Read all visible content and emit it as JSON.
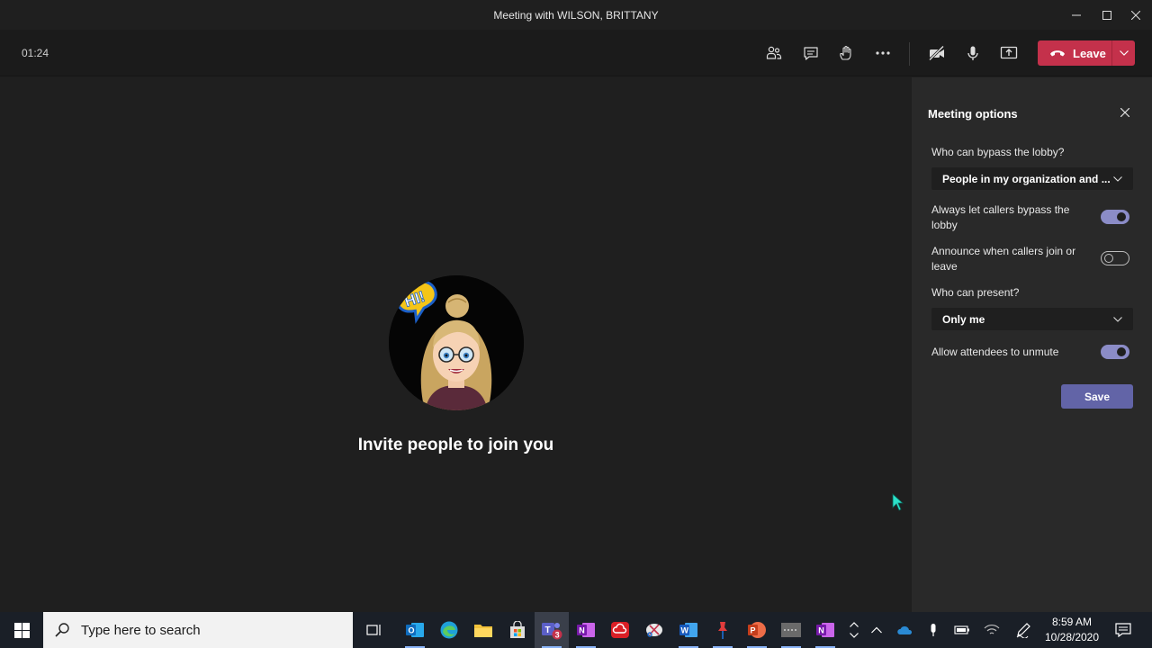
{
  "window": {
    "title": "Meeting with WILSON, BRITTANY"
  },
  "toolbar": {
    "timer": "01:24",
    "leave_label": "Leave"
  },
  "stage": {
    "invite_text": "Invite people to join you"
  },
  "meeting_options": {
    "title": "Meeting options",
    "bypass_lobby_label": "Who can bypass the lobby?",
    "bypass_lobby_value": "People in my organization and ...",
    "callers_bypass_label": "Always let callers bypass the lobby",
    "callers_bypass_on": true,
    "announce_label": "Announce when callers join or leave",
    "announce_on": false,
    "present_label": "Who can present?",
    "present_value": "Only me",
    "unmute_label": "Allow attendees to unmute",
    "unmute_on": true,
    "save_label": "Save"
  },
  "taskbar": {
    "search_placeholder": "Type here to search",
    "teams_badge": "3",
    "time": "8:59 AM",
    "date": "10/28/2020"
  },
  "colors": {
    "leave": "#c4314b",
    "accent": "#6264a7",
    "toggle_on": "#8b8cc7",
    "background": "#1f1f1f",
    "panel": "#292929"
  }
}
